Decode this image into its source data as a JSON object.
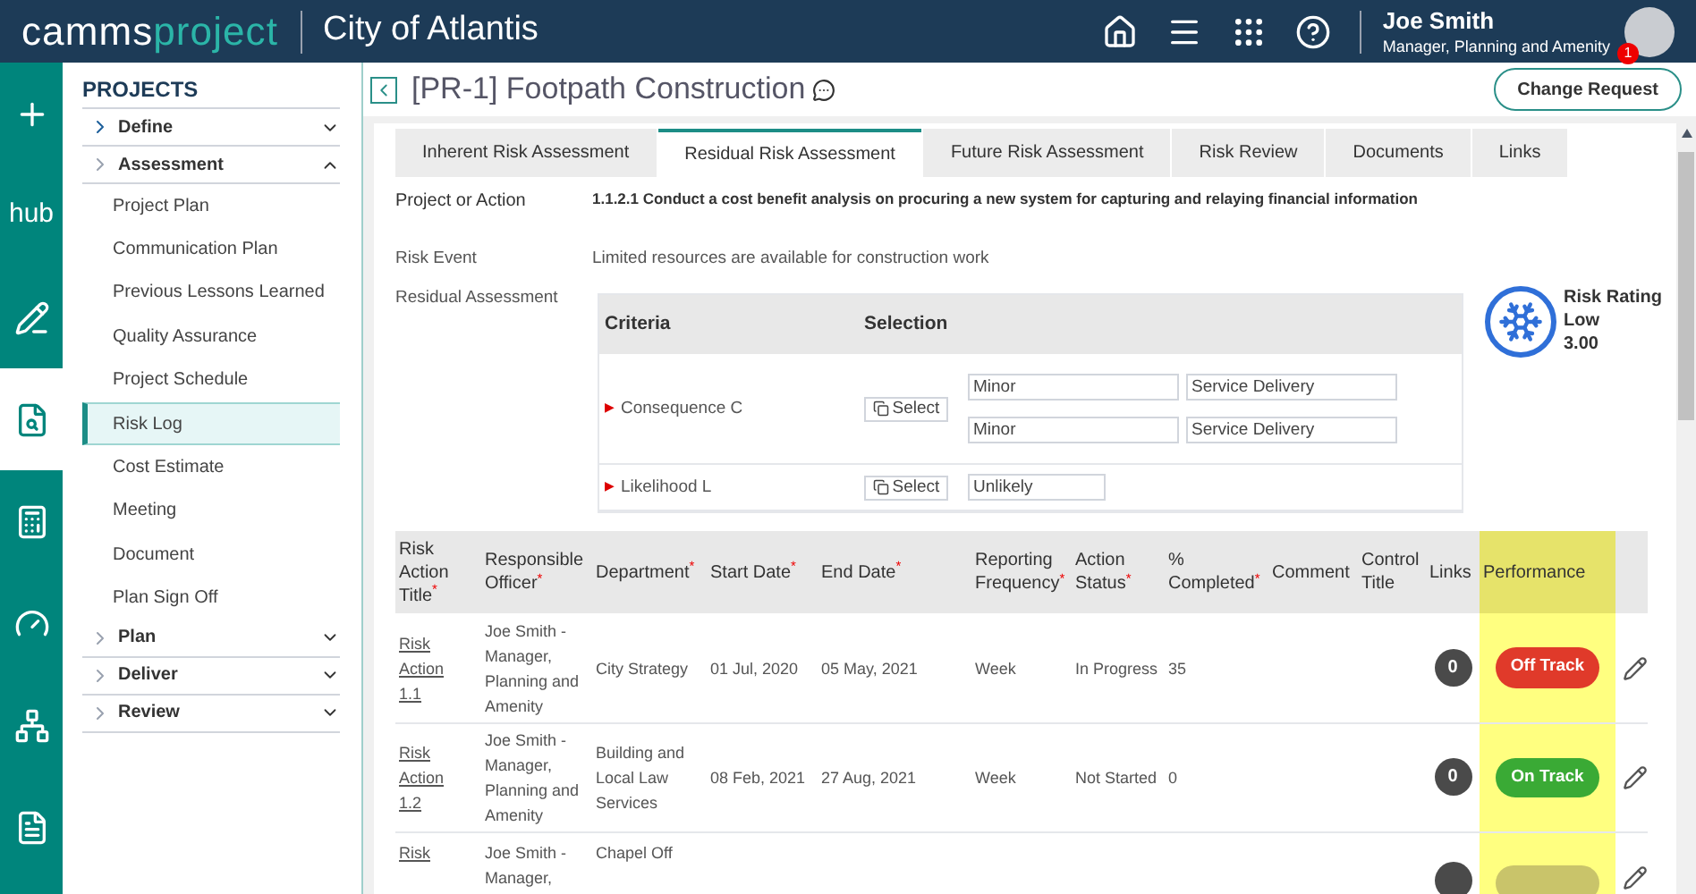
{
  "header": {
    "logo_left": "camms",
    "logo_right": "project",
    "org": "City of Atlantis",
    "user_name": "Joe Smith",
    "user_role": "Manager, Planning and Amenity",
    "notification_count": "1"
  },
  "rail": [
    {
      "selected": false
    },
    {
      "text": "hub",
      "selected": false
    },
    {
      "selected": false
    },
    {
      "selected": true
    },
    {
      "selected": false
    },
    {
      "selected": false
    },
    {
      "selected": false
    },
    {
      "selected": false
    }
  ],
  "sidebar": {
    "title": "PROJECTS",
    "groups": [
      {
        "label": "Define",
        "expanded": false
      },
      {
        "label": "Assessment",
        "expanded": true,
        "children": [
          {
            "label": "Project Plan",
            "selected": false
          },
          {
            "label": "Communication Plan",
            "selected": false
          },
          {
            "label": "Previous Lessons Learned",
            "selected": false
          },
          {
            "label": "Quality Assurance",
            "selected": false
          },
          {
            "label": "Project Schedule",
            "selected": false
          },
          {
            "label": "Risk Log",
            "selected": true
          },
          {
            "label": "Cost Estimate",
            "selected": false
          },
          {
            "label": "Meeting",
            "selected": false
          },
          {
            "label": "Document",
            "selected": false
          },
          {
            "label": "Plan Sign Off",
            "selected": false
          }
        ]
      },
      {
        "label": "Plan",
        "expanded": false
      },
      {
        "label": "Deliver",
        "expanded": false
      },
      {
        "label": "Review",
        "expanded": false
      }
    ]
  },
  "page": {
    "title": "[PR-1] Footpath Construction",
    "action_button": "Change Request"
  },
  "tabs": [
    {
      "label": "Inherent Risk Assessment",
      "selected": false
    },
    {
      "label": "Residual Risk Assessment",
      "selected": true
    },
    {
      "label": "Future Risk Assessment",
      "selected": false
    },
    {
      "label": "Risk Review",
      "selected": false
    },
    {
      "label": "Documents",
      "selected": false
    },
    {
      "label": "Links",
      "selected": false
    }
  ],
  "fields": {
    "project_label": "Project or Action",
    "project_value": "1.1.2.1 Conduct a cost benefit analysis on procuring a new system for capturing and relaying financial information",
    "event_label": "Risk Event",
    "event_value": "Limited resources are available for construction work",
    "residual_label": "Residual Assessment"
  },
  "criteria": {
    "columns": [
      "Criteria",
      "Selection"
    ],
    "rows": [
      {
        "marker": "▶",
        "name": "Consequence C",
        "select_label": "Select",
        "values": [
          [
            "Minor",
            "Service Delivery"
          ],
          [
            "Minor",
            "Service Delivery"
          ]
        ]
      },
      {
        "marker": "▶",
        "name": "Likelihood L",
        "select_label": "Select",
        "values": [
          [
            "Unlikely"
          ]
        ]
      }
    ]
  },
  "rating": {
    "title": "Risk Rating",
    "level": "Low",
    "score": "3.00"
  },
  "actions": {
    "columns": [
      {
        "label": "Risk Action Title",
        "mark": "*"
      },
      {
        "label": "Responsible Officer",
        "mark": "*"
      },
      {
        "label": "Department",
        "mark": "*"
      },
      {
        "label": "Start Date",
        "mark": "*"
      },
      {
        "label": "End Date",
        "mark": "*"
      },
      {
        "label": "Reporting Frequency",
        "mark": "*"
      },
      {
        "label": "Action Status",
        "mark": "*"
      },
      {
        "label": "% Completed",
        "mark": "*"
      },
      {
        "label": "Comment"
      },
      {
        "label": "Control Title"
      },
      {
        "label": "Links"
      },
      {
        "label": "Performance"
      }
    ],
    "rows": [
      {
        "title": "Risk Action 1.1",
        "officer": "Joe Smith - Manager, Planning and Amenity",
        "department": "City Strategy",
        "start": "01 Jul, 2020",
        "end": "05 May, 2021",
        "frequency": "Week",
        "status": "In Progress",
        "completed": "35",
        "links": "0",
        "performance": "Off Track",
        "color": "#e03a2a"
      },
      {
        "title": "Risk Action 1.2",
        "officer": "Joe Smith - Manager, Planning and Amenity",
        "department": "Building and Local Law Services",
        "start": "08 Feb, 2021",
        "end": "27 Aug, 2021",
        "frequency": "Week",
        "status": "Not Started",
        "completed": "0",
        "links": "0",
        "performance": "On Track",
        "color": "#3aaa35"
      },
      {
        "title": "Risk",
        "officer": "Joe Smith - Manager,",
        "department": "Chapel Off",
        "color": "#c9c46a"
      }
    ]
  }
}
